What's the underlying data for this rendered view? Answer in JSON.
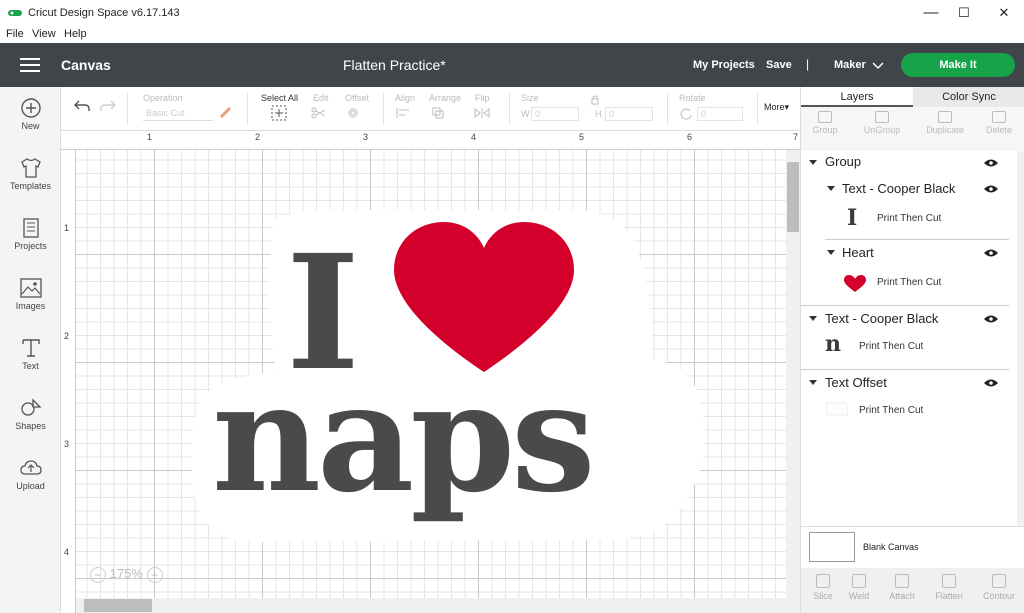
{
  "window": {
    "title": "Cricut Design Space  v6.17.143",
    "minimize": "—",
    "maximize": "☐",
    "close": "✕"
  },
  "menu": [
    "File",
    "View",
    "Help"
  ],
  "header": {
    "section": "Canvas",
    "project_name": "Flatten Practice*",
    "my_projects": "My Projects",
    "save": "Save",
    "separator": "|",
    "machine": "Maker",
    "make_it": "Make It"
  },
  "left_tools": [
    "New",
    "Templates",
    "Projects",
    "Images",
    "Text",
    "Shapes",
    "Upload"
  ],
  "edit_toolbar": {
    "operation_label": "Operation",
    "operation_value": "Basic Cut",
    "select_all": "Select All",
    "edit": "Edit",
    "offset": "Offset",
    "align": "Align",
    "arrange": "Arrange",
    "flip": "Flip",
    "size": "Size",
    "w_label": "W",
    "w_value": "0",
    "h_label": "H",
    "h_value": "0",
    "rotate": "Rotate",
    "rotate_value": "0",
    "more": "More▾"
  },
  "rulers": {
    "top": [
      "1",
      "2",
      "3",
      "4",
      "5",
      "6",
      "7"
    ],
    "left": [
      "1",
      "2",
      "3",
      "4"
    ]
  },
  "canvas": {
    "zoom": "175%",
    "design_line1": "I",
    "design_line2": "naps",
    "heart_color": "#d3002b",
    "text_color": "#4a4a4a"
  },
  "panel": {
    "tabs": [
      "Layers",
      "Color Sync"
    ],
    "layer_tools": [
      "Group",
      "UnGroup",
      "Duplicate",
      "Delete"
    ],
    "layers": {
      "group": "Group",
      "text_cooper_1": "Text - Cooper Black",
      "text_cooper_1_sub": "Print Then Cut",
      "heart": "Heart",
      "heart_sub": "Print Then Cut",
      "text_cooper_2": "Text - Cooper Black",
      "text_cooper_2_sub": "Print Then Cut",
      "text_offset": "Text Offset",
      "text_offset_sub": "Print Then Cut"
    },
    "blank_canvas": "Blank Canvas",
    "bottom_tools": [
      "Slice",
      "Weld",
      "Attach",
      "Flatten",
      "Contour"
    ]
  }
}
